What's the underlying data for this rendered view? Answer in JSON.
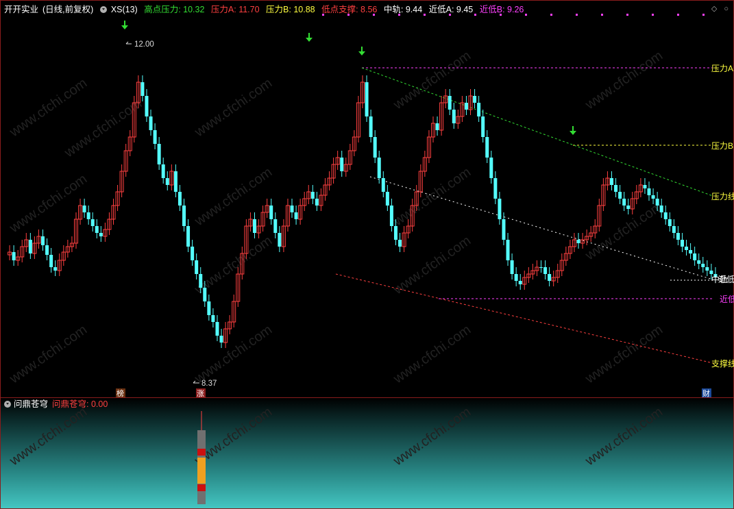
{
  "header": {
    "stock_name": "开开实业",
    "period": "(日线,前复权)",
    "indicator_main": "XS(13)",
    "items": [
      {
        "label": "高点压力: 10.32",
        "color": "#33dd33"
      },
      {
        "label": "压力A: 11.70",
        "color": "#ff4040"
      },
      {
        "label": "压力B: 10.88",
        "color": "#ffff40"
      },
      {
        "label": "低点支撑: 8.56",
        "color": "#ff4040"
      },
      {
        "label": "中轨: 9.44",
        "color": "#ffffff"
      },
      {
        "label": "近低A: 9.45",
        "color": "#ffffff"
      },
      {
        "label": "近低B: 9.26",
        "color": "#ff40ff"
      }
    ]
  },
  "price_labels": {
    "high": "12.00",
    "low": "8.37"
  },
  "right_labels": {
    "pressure_a": "压力A",
    "pressure_b": "压力B",
    "pressure_line": "压力线",
    "mid": "中轨",
    "near_low_a": "近低A",
    "near_low_b": "近低B",
    "support_line": "支撑线"
  },
  "badges": {
    "left": "榜",
    "mid": "涨",
    "right": "财"
  },
  "sub_header": {
    "name": "问鼎苍穹",
    "value_label": "问鼎苍穹: 0.00"
  },
  "watermark": "www.cfchi.com",
  "colors": {
    "up": "#ff4040",
    "down": "#54ffff",
    "bg": "#000000",
    "pink": "#ff40ff",
    "yellow": "#ffff40",
    "green": "#33dd33"
  }
}
